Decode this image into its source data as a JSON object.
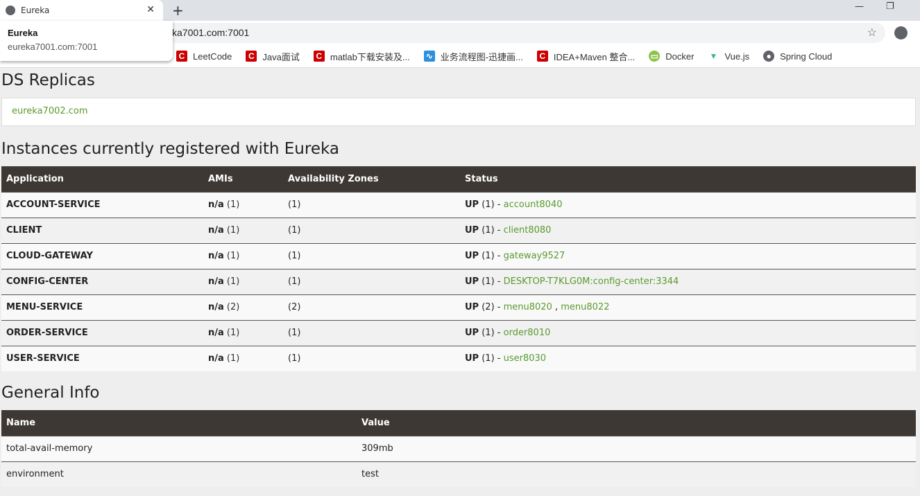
{
  "browser": {
    "tab_title": "Eureka",
    "url": "eureka7001.com:7001",
    "url_visible": "ka7001.com:7001",
    "popup": {
      "title": "Eureka",
      "url": "eureka7001.com:7001"
    },
    "bookmarks": [
      {
        "label": "LeetCode"
      },
      {
        "label": "Java面试"
      },
      {
        "label": "matlab下载安装及..."
      },
      {
        "label": "业务流程图-迅捷画..."
      },
      {
        "label": "IDEA+Maven 整合..."
      },
      {
        "label": "Docker"
      },
      {
        "label": "Vue.js"
      },
      {
        "label": "Spring Cloud"
      }
    ]
  },
  "ds_replicas": {
    "title": "DS Replicas",
    "replica": "eureka7002.com"
  },
  "instances": {
    "title": "Instances currently registered with Eureka",
    "headers": [
      "Application",
      "AMIs",
      "Availability Zones",
      "Status"
    ],
    "rows": [
      {
        "app": "ACCOUNT-SERVICE",
        "ami": "n/a",
        "ami_count": "(1)",
        "zones": "(1)",
        "status": "UP",
        "status_count": "(1) -",
        "links": [
          "account8040"
        ]
      },
      {
        "app": "CLIENT",
        "ami": "n/a",
        "ami_count": "(1)",
        "zones": "(1)",
        "status": "UP",
        "status_count": "(1) -",
        "links": [
          "client8080"
        ]
      },
      {
        "app": "CLOUD-GATEWAY",
        "ami": "n/a",
        "ami_count": "(1)",
        "zones": "(1)",
        "status": "UP",
        "status_count": "(1) -",
        "links": [
          "gateway9527"
        ]
      },
      {
        "app": "CONFIG-CENTER",
        "ami": "n/a",
        "ami_count": "(1)",
        "zones": "(1)",
        "status": "UP",
        "status_count": "(1) -",
        "links": [
          "DESKTOP-T7KLG0M:config-center:3344"
        ]
      },
      {
        "app": "MENU-SERVICE",
        "ami": "n/a",
        "ami_count": "(2)",
        "zones": "(2)",
        "status": "UP",
        "status_count": "(2) -",
        "links": [
          "menu8020",
          "menu8022"
        ]
      },
      {
        "app": "ORDER-SERVICE",
        "ami": "n/a",
        "ami_count": "(1)",
        "zones": "(1)",
        "status": "UP",
        "status_count": "(1) -",
        "links": [
          "order8010"
        ]
      },
      {
        "app": "USER-SERVICE",
        "ami": "n/a",
        "ami_count": "(1)",
        "zones": "(1)",
        "status": "UP",
        "status_count": "(1) -",
        "links": [
          "user8030"
        ]
      }
    ]
  },
  "general": {
    "title": "General Info",
    "headers": [
      "Name",
      "Value"
    ],
    "rows": [
      {
        "name": "total-avail-memory",
        "value": "309mb"
      },
      {
        "name": "environment",
        "value": "test"
      }
    ]
  }
}
